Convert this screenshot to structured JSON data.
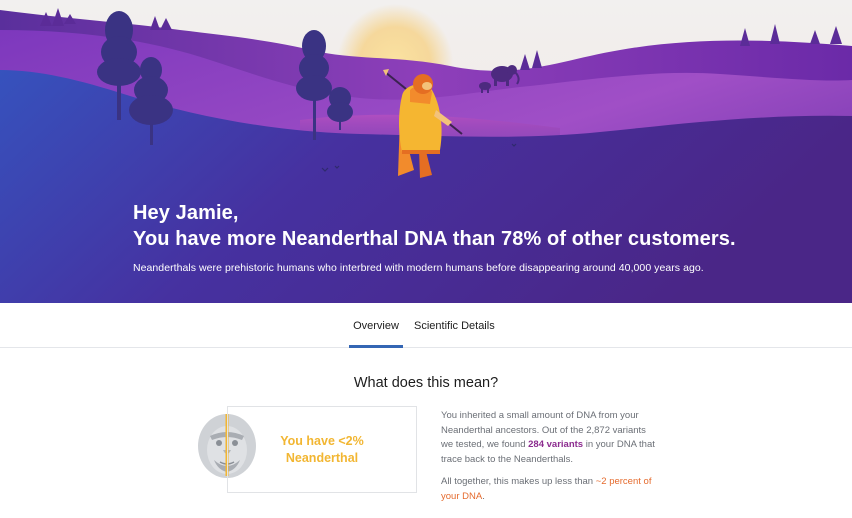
{
  "hero": {
    "greeting": "Hey Jamie,",
    "headline": "You have more Neanderthal DNA than 78% of other customers.",
    "subline": "Neanderthals were prehistoric humans who interbred with modern humans before disappearing around 40,000 years ago.",
    "colors": {
      "sky_top": "#f3f1f0",
      "sun_glow": "#f6d58b",
      "hill_purple": "#7f35b8",
      "field_blue": "#3b4fb7",
      "field_violet": "#4a2a92",
      "figure_orange": "#f28b2c",
      "figure_yellow": "#f5b631"
    }
  },
  "tabs": [
    {
      "label": "Overview",
      "active": true
    },
    {
      "label": "Scientific Details",
      "active": false
    }
  ],
  "section": {
    "title": "What does this mean?",
    "result_line1": "You have <2%",
    "result_line2": "Neanderthal",
    "desc1_a": "You inherited a small amount of DNA from your Neanderthal ancestors.  Out of the 2,872 variants we tested, we found ",
    "desc1_b": "284 variants",
    "desc1_c": " in your DNA that trace back to the Neanderthals.",
    "desc2_a": "All together, this makes up less than ",
    "desc2_b": "~2 percent of your DNA",
    "desc2_c": "."
  },
  "icons": [
    "moon-icon",
    "neanderthal-face-icon",
    "mammoth-icon"
  ],
  "accent_colors": {
    "tab_underline": "#3466b4",
    "result_yellow": "#f2b632",
    "variant_purple": "#8c2c8f",
    "percent_orange": "#e56b2e"
  }
}
